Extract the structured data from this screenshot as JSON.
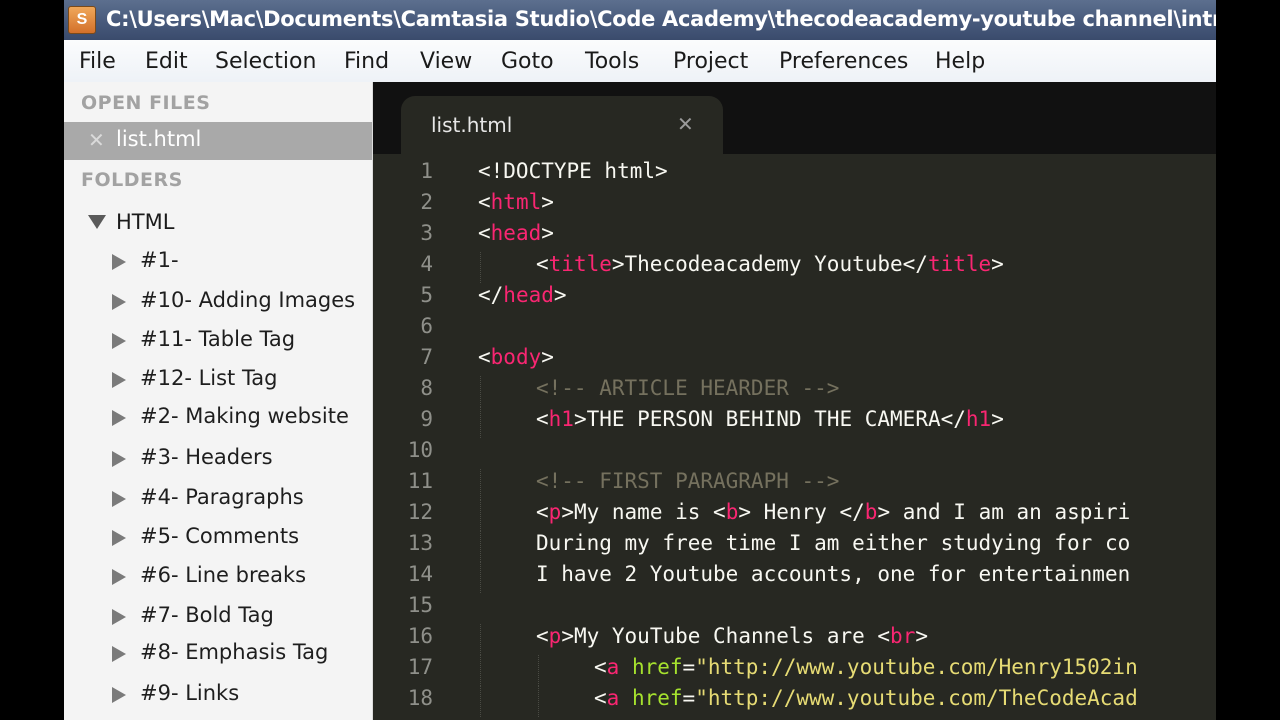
{
  "window": {
    "title": "C:\\Users\\Mac\\Documents\\Camtasia Studio\\Code Academy\\thecodeacademy-youtube channel\\intro",
    "app_icon": "S"
  },
  "menu": [
    "File",
    "Edit",
    "Selection",
    "Find",
    "View",
    "Goto",
    "Tools",
    "Project",
    "Preferences",
    "Help"
  ],
  "sidebar": {
    "open_files_heading": "OPEN FILES",
    "open_file": "list.html",
    "close_glyph": "✕",
    "folders_heading": "FOLDERS",
    "root_folder": "HTML",
    "folders": [
      "#1-",
      "#10- Adding Images",
      "#11- Table Tag",
      "#12- List Tag",
      "#2- Making website",
      "#3- Headers",
      "#4- Paragraphs",
      "#5- Comments",
      "#6- Line breaks",
      "#7- Bold Tag",
      "#8- Emphasis Tag",
      "#9- Links"
    ]
  },
  "tab": {
    "name": "list.html",
    "close_glyph": "✕"
  },
  "code_lines": [
    {
      "n": "1",
      "indent": 0,
      "tokens": [
        [
          "p",
          "<!DOCTYPE html>"
        ]
      ]
    },
    {
      "n": "2",
      "indent": 0,
      "tokens": [
        [
          "p",
          "<"
        ],
        [
          "t",
          "html"
        ],
        [
          "p",
          ">"
        ]
      ]
    },
    {
      "n": "3",
      "indent": 0,
      "tokens": [
        [
          "p",
          "<"
        ],
        [
          "t",
          "head"
        ],
        [
          "p",
          ">"
        ]
      ]
    },
    {
      "n": "4",
      "indent": 1,
      "tokens": [
        [
          "p",
          "<"
        ],
        [
          "t",
          "title"
        ],
        [
          "p",
          ">Thecodeacademy Youtube</"
        ],
        [
          "t",
          "title"
        ],
        [
          "p",
          ">"
        ]
      ]
    },
    {
      "n": "5",
      "indent": 0,
      "tokens": [
        [
          "p",
          "</"
        ],
        [
          "t",
          "head"
        ],
        [
          "p",
          ">"
        ]
      ]
    },
    {
      "n": "6",
      "indent": 0,
      "tokens": []
    },
    {
      "n": "7",
      "indent": 0,
      "tokens": [
        [
          "p",
          "<"
        ],
        [
          "t",
          "body"
        ],
        [
          "p",
          ">"
        ]
      ]
    },
    {
      "n": "8",
      "indent": 1,
      "tokens": [
        [
          "c",
          "<!-- ARTICLE HEARDER -->"
        ]
      ]
    },
    {
      "n": "9",
      "indent": 1,
      "tokens": [
        [
          "p",
          "<"
        ],
        [
          "t",
          "h1"
        ],
        [
          "p",
          ">THE PERSON BEHIND THE CAMERA</"
        ],
        [
          "t",
          "h1"
        ],
        [
          "p",
          ">"
        ]
      ]
    },
    {
      "n": "10",
      "indent": 0,
      "tokens": []
    },
    {
      "n": "11",
      "indent": 1,
      "tokens": [
        [
          "c",
          "<!-- FIRST PARAGRAPH -->"
        ]
      ]
    },
    {
      "n": "12",
      "indent": 1,
      "tokens": [
        [
          "p",
          "<"
        ],
        [
          "t",
          "p"
        ],
        [
          "p",
          ">My name is <"
        ],
        [
          "t",
          "b"
        ],
        [
          "p",
          "> Henry </"
        ],
        [
          "t",
          "b"
        ],
        [
          "p",
          "> and I am an aspiri"
        ]
      ]
    },
    {
      "n": "13",
      "indent": 1,
      "tokens": [
        [
          "p",
          "During my free time I am either studying for co"
        ]
      ]
    },
    {
      "n": "14",
      "indent": 1,
      "tokens": [
        [
          "p",
          "I have 2 Youtube accounts, one for entertainmen"
        ]
      ]
    },
    {
      "n": "15",
      "indent": 0,
      "tokens": []
    },
    {
      "n": "16",
      "indent": 1,
      "tokens": [
        [
          "p",
          "<"
        ],
        [
          "t",
          "p"
        ],
        [
          "p",
          ">My YouTube Channels are <"
        ],
        [
          "t",
          "br"
        ],
        [
          "p",
          ">"
        ]
      ]
    },
    {
      "n": "17",
      "indent": 2,
      "tokens": [
        [
          "p",
          "<"
        ],
        [
          "t",
          "a"
        ],
        [
          "p",
          " "
        ],
        [
          "a",
          "href"
        ],
        [
          "p",
          "="
        ],
        [
          "s",
          "\"http://www.youtube.com/Henry1502in"
        ]
      ]
    },
    {
      "n": "18",
      "indent": 2,
      "tokens": [
        [
          "p",
          "<"
        ],
        [
          "t",
          "a"
        ],
        [
          "p",
          " "
        ],
        [
          "a",
          "href"
        ],
        [
          "p",
          "="
        ],
        [
          "s",
          "\"http://www.youtube.com/TheCodeAcad"
        ]
      ]
    }
  ],
  "colors": {
    "editor_bg": "#272822",
    "tag": "#f92672",
    "attribute": "#a6e22e",
    "string": "#e6db74",
    "comment": "#75715e",
    "text": "#f8f8f2",
    "line_number": "#8f908a",
    "sidebar_selected": "#a9a9a9"
  }
}
